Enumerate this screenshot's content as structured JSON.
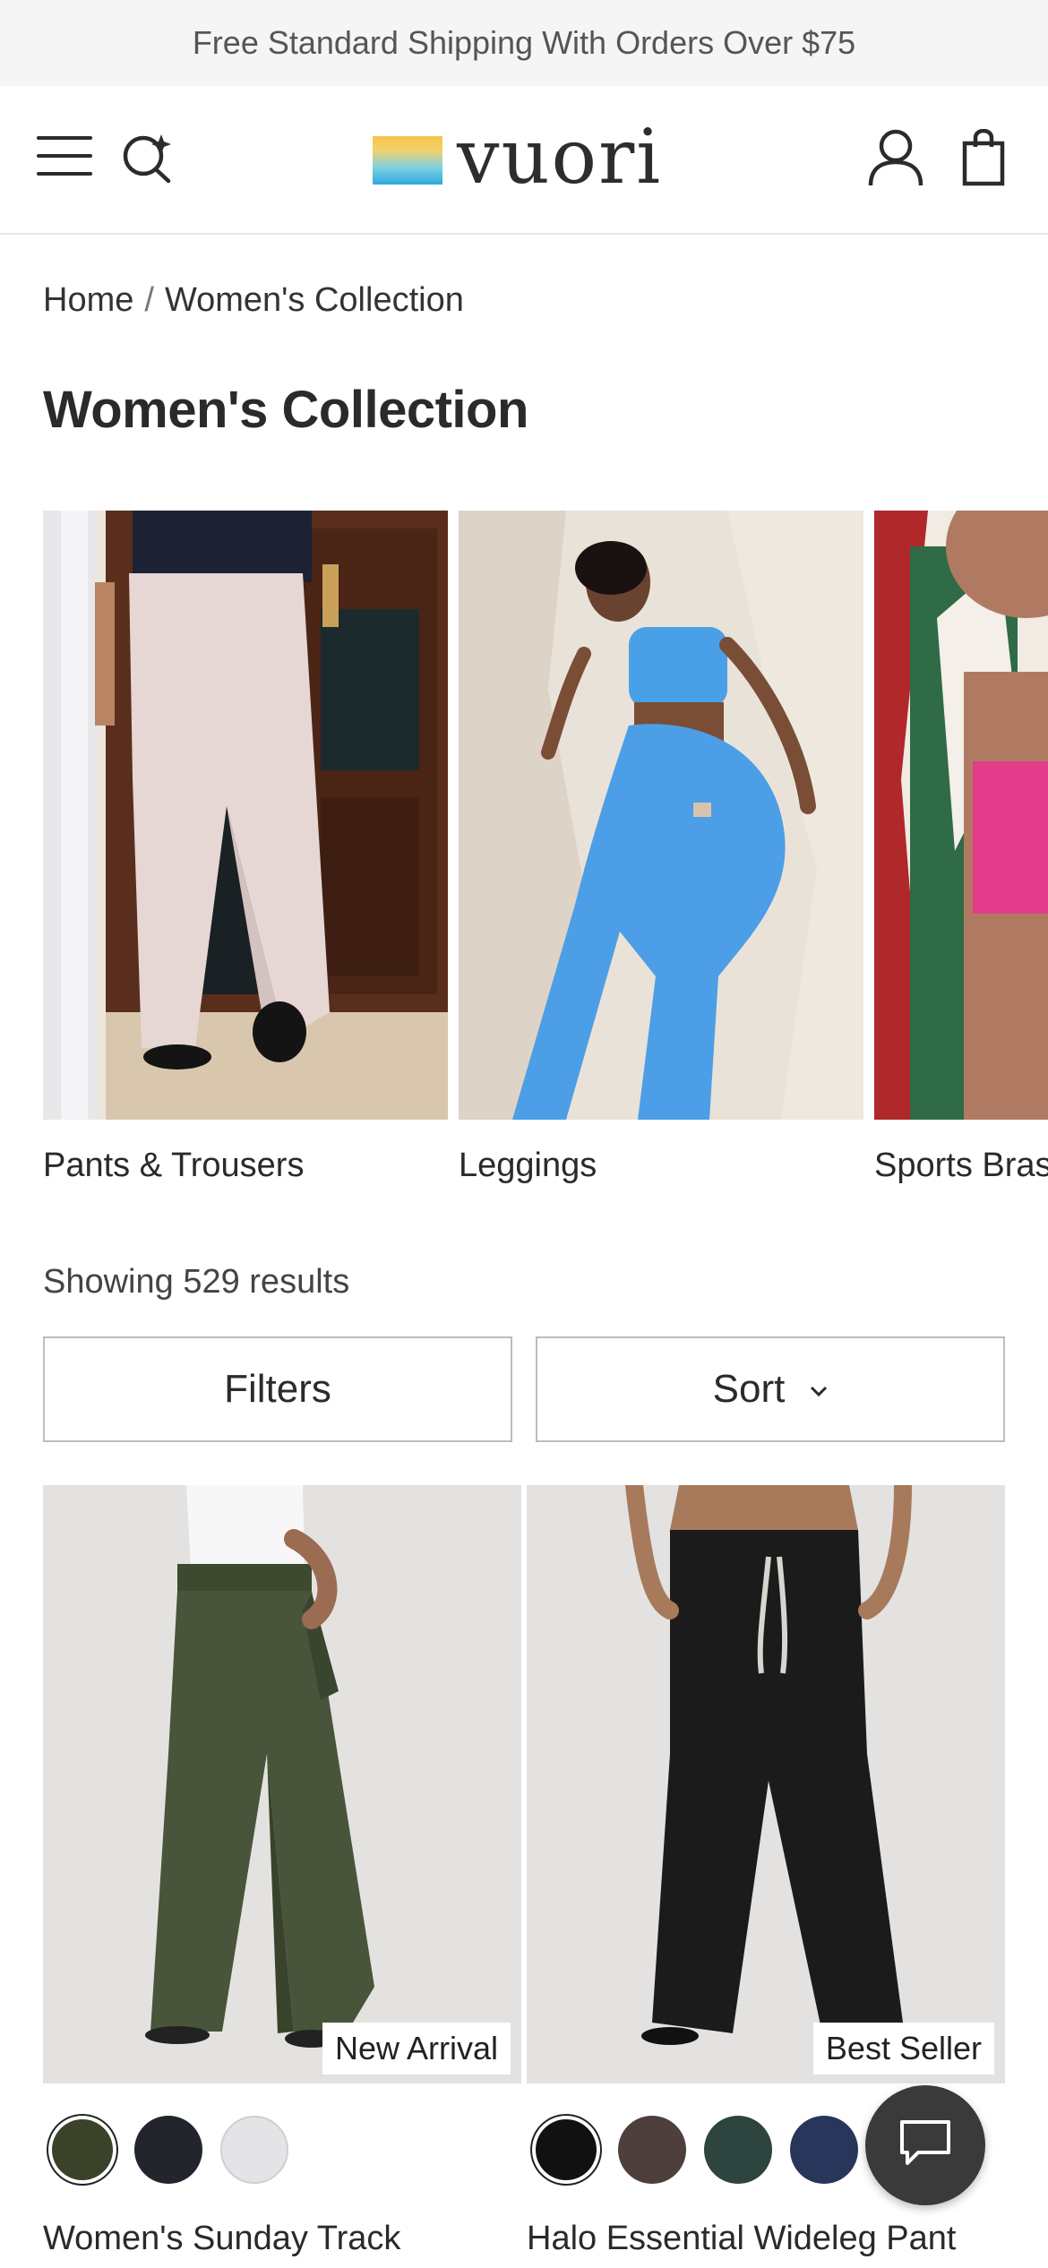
{
  "promo": {
    "text": "Free Standard Shipping With Orders Over $75"
  },
  "header": {
    "logo_text": "vuori",
    "icons": [
      "menu-icon",
      "search-icon",
      "account-icon",
      "bag-icon"
    ]
  },
  "breadcrumb": {
    "home": "Home",
    "separator": "/",
    "current": "Women's Collection"
  },
  "page_title": "Women's Collection",
  "categories": [
    {
      "label": "Pants & Trousers"
    },
    {
      "label": "Leggings"
    },
    {
      "label": "Sports Bras"
    }
  ],
  "results_text": "Showing 529 results",
  "controls": {
    "filters_label": "Filters",
    "sort_label": "Sort"
  },
  "products": [
    {
      "name": "Women's Sunday Track",
      "badge": "New Arrival",
      "swatches": [
        "#3a4229",
        "#22252c",
        "#e4e3e6"
      ]
    },
    {
      "name": "Halo Essential Wideleg Pant",
      "badge": "Best Seller",
      "swatches": [
        "#111111",
        "#4e3f3d",
        "#2e443e",
        "#27365a"
      ]
    }
  ],
  "colors": {
    "promo_bg": "#f5f5f5",
    "text": "#2b2b2b",
    "chat_bg": "#3a3a3a"
  }
}
